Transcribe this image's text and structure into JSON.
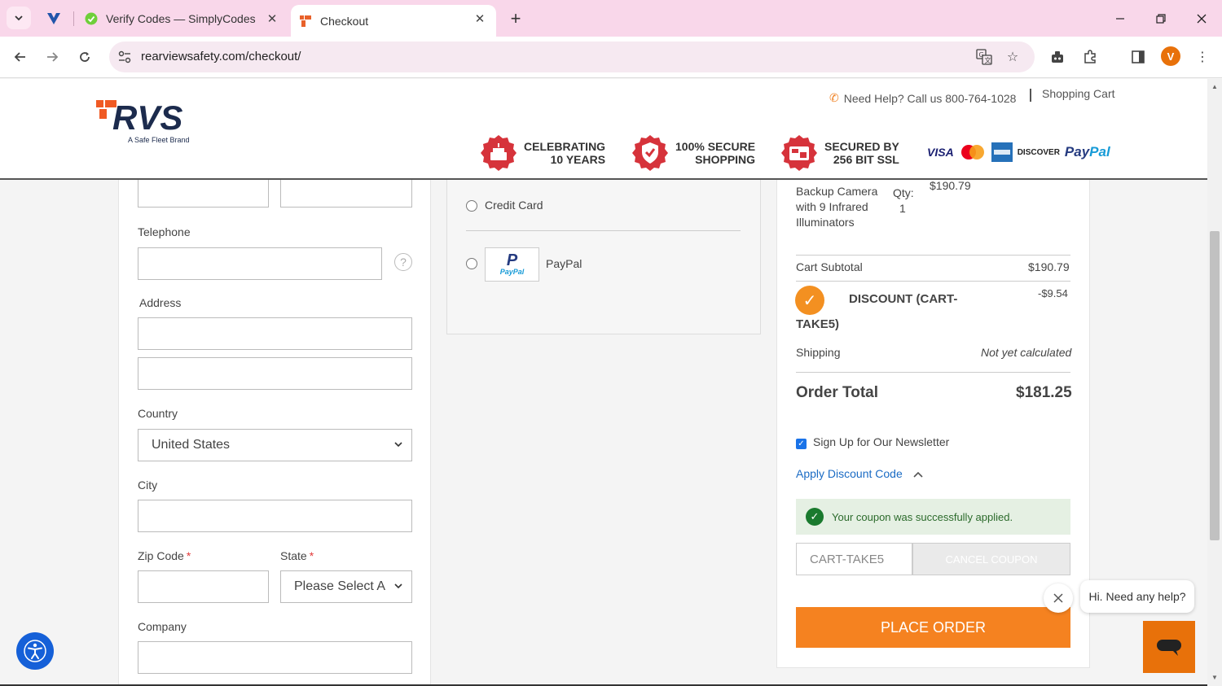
{
  "browser": {
    "tabs": [
      {
        "title": "Verify Codes — SimplyCodes"
      },
      {
        "title": "Checkout"
      }
    ],
    "url": "rearviewsafety.com/checkout/",
    "profile_initial": "V"
  },
  "header": {
    "logo_text": "RVS",
    "logo_tagline": "A Safe Fleet Brand",
    "help_text": "Need Help? Call us 800-764-1028",
    "cart_link": "Shopping Cart",
    "badges": [
      {
        "line1": "CELEBRATING",
        "line2": "10 YEARS"
      },
      {
        "line1": "100% SECURE",
        "line2": "SHOPPING"
      },
      {
        "line1": "SECURED BY",
        "line2": "256 BIT SSL"
      }
    ],
    "payments": {
      "visa": "VISA",
      "discover": "DISCOVER",
      "paypal_a": "Pay",
      "paypal_b": "Pal"
    }
  },
  "form": {
    "telephone_label": "Telephone",
    "help_symbol": "?",
    "address_label": "Address",
    "country_label": "Country",
    "country_value": "United States",
    "city_label": "City",
    "zip_label": "Zip Code",
    "state_label": "State",
    "state_value": "Please Select A",
    "company_label": "Company",
    "required_mark": "*"
  },
  "payment": {
    "credit_card_label": "Credit Card",
    "paypal_label": "PayPal",
    "paypal_logo_text": "PayPal"
  },
  "summary": {
    "product_name_lines": [
      "Backup Camera",
      "with 9 Infrared",
      "Illuminators"
    ],
    "qty_label": "Qty:",
    "qty_value": "1",
    "product_price": "$190.79",
    "subtotal_label": "Cart Subtotal",
    "subtotal_value": "$190.79",
    "discount_label_1": "DISCOUNT (CART-",
    "discount_label_2": "TAKE5)",
    "discount_value": "-$9.54",
    "shipping_label": "Shipping",
    "shipping_value": "Not yet calculated",
    "total_label": "Order Total",
    "total_value": "$181.25",
    "newsletter_label": "Sign Up for Our Newsletter",
    "apply_discount_label": "Apply Discount Code",
    "coupon_message": "Your coupon was successfully applied.",
    "coupon_code": "CART-TAKE5",
    "cancel_coupon_label": "CANCEL COUPON",
    "place_order_label": "PLACE ORDER"
  },
  "chat": {
    "greeting": "Hi. Need any help?"
  },
  "colors": {
    "accent_orange": "#f58220",
    "brand_navy": "#1c2b4d",
    "badge_red": "#d6333b",
    "link_blue": "#1a6bc4",
    "success_green": "#1a7a2e"
  }
}
